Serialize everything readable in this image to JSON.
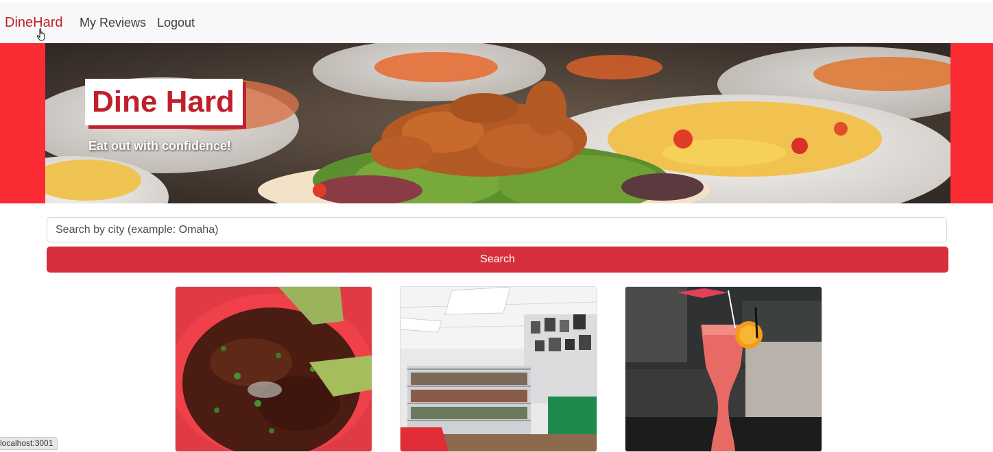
{
  "navbar": {
    "brand": "DineHard",
    "links": [
      {
        "label": "My Reviews"
      },
      {
        "label": "Logout"
      }
    ]
  },
  "hero": {
    "title": "Dine Hard",
    "subtitle": "Eat out with confidence!"
  },
  "search": {
    "placeholder": "Search by city (example: Omaha)",
    "button_label": "Search"
  },
  "cards": [
    {
      "image": "soup-photo"
    },
    {
      "image": "store-interior-photo"
    },
    {
      "image": "cocktail-photo"
    }
  ],
  "status_bar": {
    "url": "localhost:3001"
  },
  "colors": {
    "brand_red": "#c0202c",
    "hero_side_red": "#fb2b33",
    "button_red": "#d62e3b",
    "navbar_bg": "#f8f8fb"
  }
}
